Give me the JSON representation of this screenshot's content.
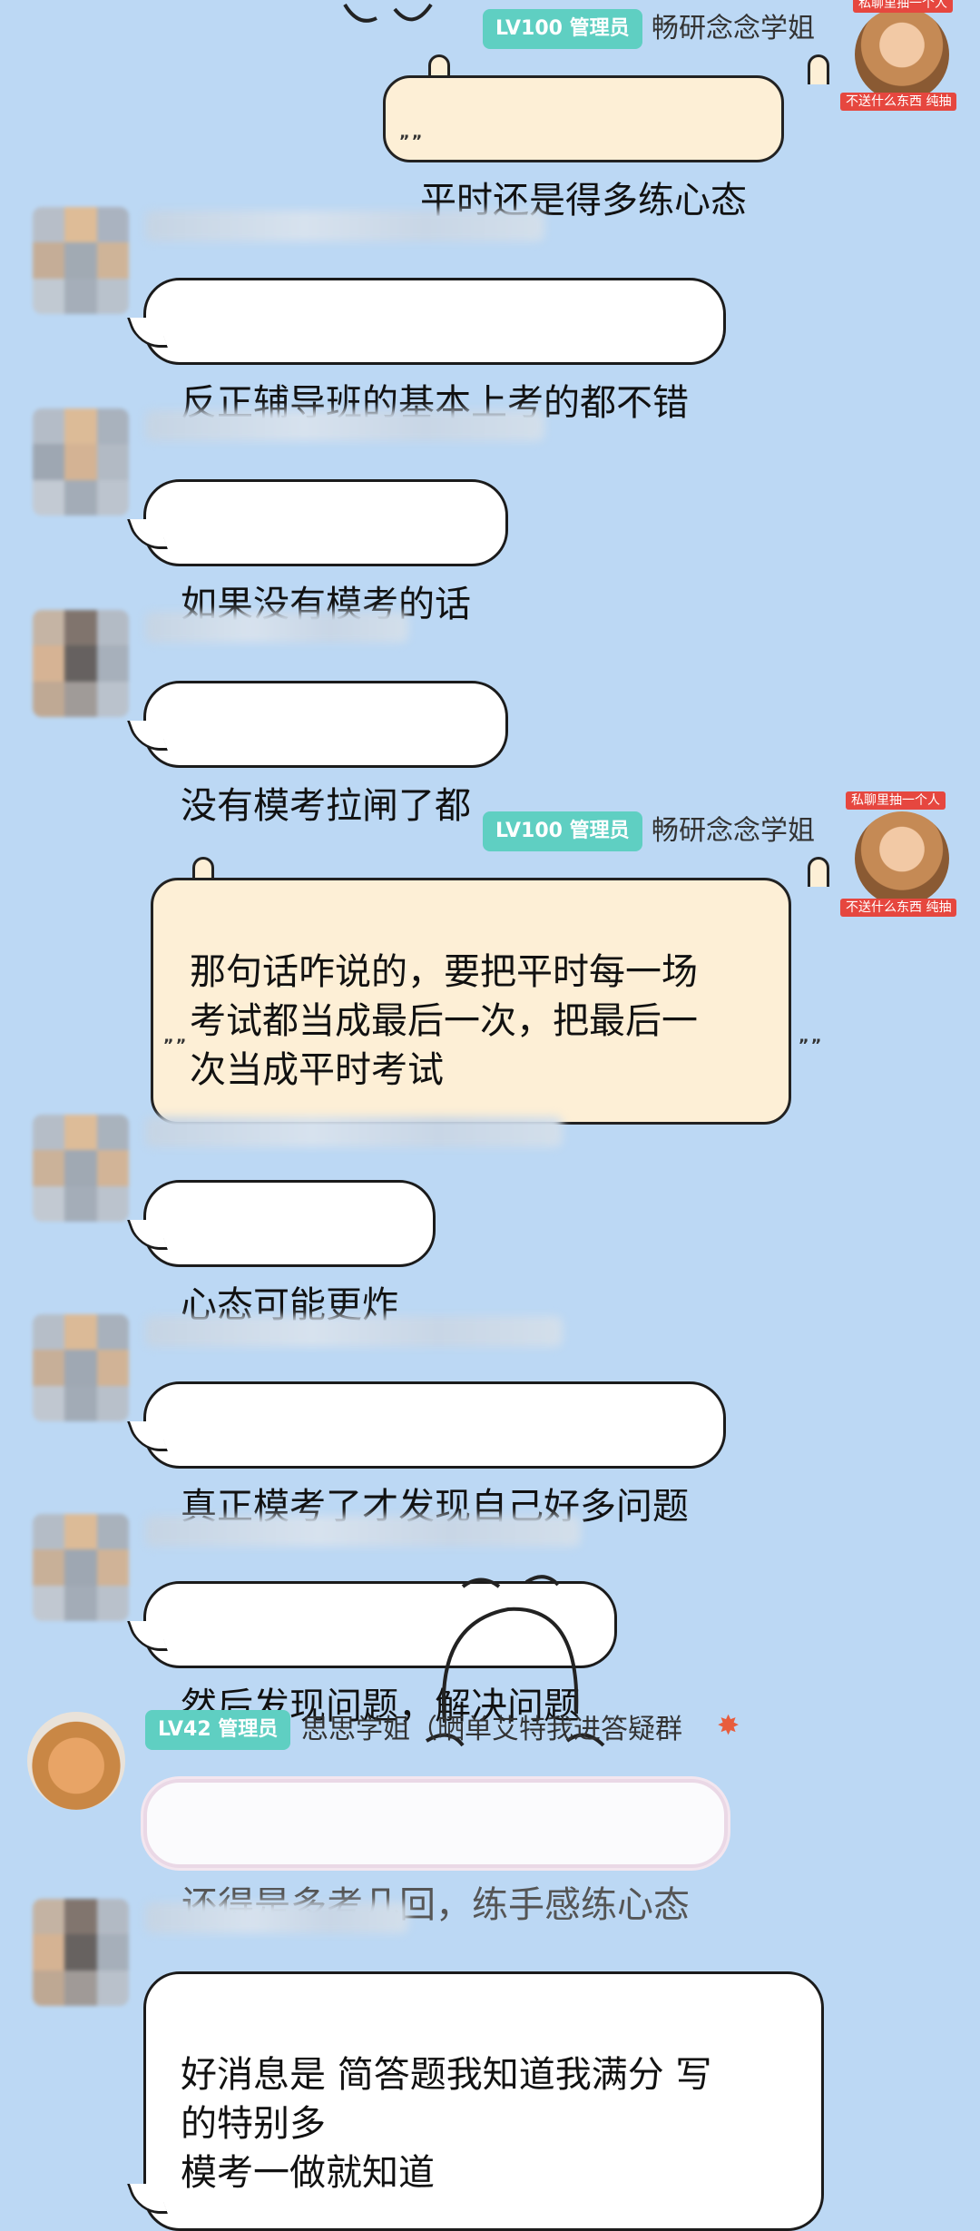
{
  "admin_badge": "LV100 管理员",
  "admin_name": "畅研念念学姐",
  "admin_tag_top_1": "私聊里抽一个人",
  "admin_tag_bottom_1": "不送什么东西 纯抽",
  "admin_tag_top_2": "私聊里抽一个人",
  "admin_tag_bottom_2": "不送什么东西 纯抽",
  "messages": {
    "m1": "平时还是得多练心态",
    "m2": "反正辅导班的基本上考的都不错",
    "m3": "如果没有模考的话",
    "m4": "没有模考拉闸了都",
    "m5": "那句话咋说的，要把平时每一场\n考试都当成最后一次，把最后一\n次当成平时考试",
    "m6": "心态可能更炸",
    "m7": "真正模考了才发现自己好多问题",
    "m8": "然后发现问题，解决问题",
    "m9": "还得是多考几回，练手感练心态",
    "m10": "好消息是 简答题我知道我满分 写\n的特别多\n模考一做就知道"
  },
  "lv42_badge": "LV42 管理员",
  "lv42_name": "思思学姐（晒单艾特我进答疑群",
  "colors": {
    "background": "#bcd8f4",
    "badge": "#5fcfc2",
    "admin_bubble": "#fdefd6",
    "tag_red": "#e6473f"
  }
}
